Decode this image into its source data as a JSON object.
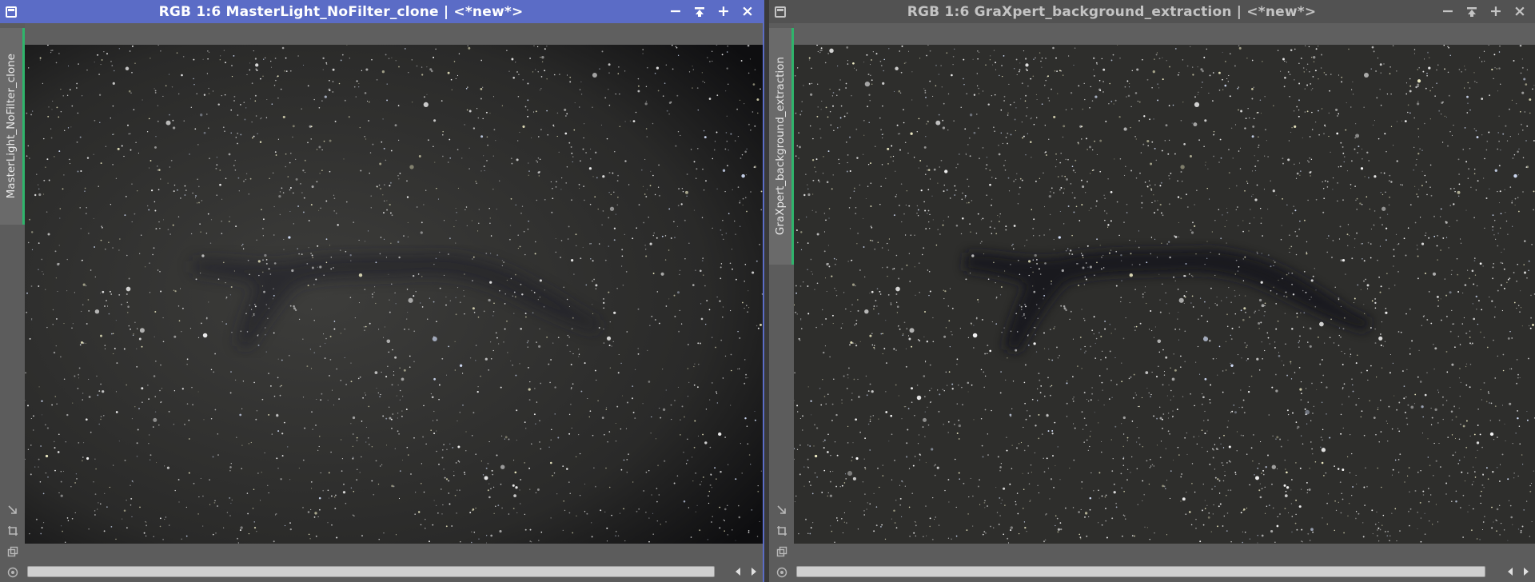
{
  "windows": [
    {
      "id": "left",
      "title": "RGB 1:6 MasterLight_NoFilter_clone | <*new*>",
      "side_tab": "MasterLight_NoFilter_clone",
      "active": true,
      "controls": {
        "minimize": "−",
        "shade": "⌅",
        "maximize": "+",
        "close": "×"
      },
      "tools": [
        "link-arrow-icon",
        "crop-icon",
        "windows-icon",
        "target-icon"
      ]
    },
    {
      "id": "right",
      "title": "RGB 1:6 GraXpert_background_extraction | <*new*>",
      "side_tab": "GraXpert_background_extraction",
      "active": false,
      "controls": {
        "minimize": "−",
        "shade": "⌅",
        "maximize": "+",
        "close": "×"
      },
      "tools": [
        "link-arrow-icon",
        "crop-icon",
        "windows-icon",
        "target-icon"
      ]
    }
  ],
  "colors": {
    "active_titlebar": "#5b6cc6",
    "inactive_titlebar": "#525252",
    "tab_accent": "#2fb46b"
  }
}
